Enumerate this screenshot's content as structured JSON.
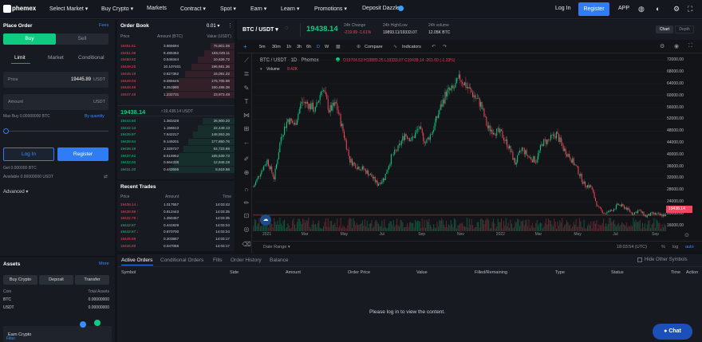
{
  "topbar": {
    "logo": "phemex",
    "nav": [
      "Select Market ▾",
      "Buy Crypto ▾",
      "Markets",
      "Contract ▾",
      "Spot ▾",
      "Earn ▾",
      "Learn ▾",
      "Promotions ▾",
      "Deposit Dazzle"
    ],
    "login": "Log In",
    "register": "Register",
    "app": "APP"
  },
  "order_form": {
    "title": "Place Order",
    "fees": "Fees",
    "buy": "Buy",
    "sell": "Sell",
    "tabs": [
      "Limit",
      "Market",
      "Conditional"
    ],
    "price_label": "Price",
    "price_value": "19445.89",
    "price_unit": "USDT",
    "amount_label": "Amount",
    "amount_unit": "USDT",
    "max_buy": "Max Buy 0.00000000 BTC",
    "by_quantity": "By quantity",
    "login_btn": "Log In",
    "register_btn": "Register",
    "get": "Get 0.000000 BTC",
    "available": "Available 0.00000000 USDT",
    "advanced": "Advanced ▾"
  },
  "assets": {
    "title": "Assets",
    "more": "More",
    "buttons": [
      "Buy Crypto",
      "Deposit",
      "Transfer"
    ],
    "coin_label": "Coin",
    "total_label": "Total Assets",
    "rows": [
      {
        "coin": "BTC",
        "total": "0.00000000"
      },
      {
        "coin": "USDT",
        "total": "0.00000000"
      }
    ],
    "earn": "Earn Crypto",
    "filter": "Filter"
  },
  "orderbook": {
    "title": "Order Book",
    "precision": "0.01 ▾",
    "headers": [
      "Price",
      "Amount (BTC)",
      "Value (USDT)"
    ],
    "asks": [
      [
        "19451.61",
        "3.865694",
        "76,801.06"
      ],
      [
        "19451.06",
        "8.485362",
        "165,049.11"
      ],
      [
        "19450.62",
        "0.546344",
        "10,626.72"
      ],
      [
        "19449.25",
        "10.107401",
        "196,581.36"
      ],
      [
        "19449.19",
        "0.827352",
        "16,091.32"
      ],
      [
        "19449.03",
        "9.085645",
        "176,706.98"
      ],
      [
        "19448.46",
        "8.251980",
        "160,486.38"
      ],
      [
        "19447.46",
        "1.232731",
        "23,973.48"
      ]
    ],
    "mid_price": "19438.14",
    "mid_value": "≈19,438.14 USDT",
    "bids": [
      [
        "19444.60",
        "1.383428",
        "26,900.20"
      ],
      [
        "19442.13",
        "1.156613",
        "22,448.13"
      ],
      [
        "19439.97",
        "7.642217",
        "148,553.26"
      ],
      [
        "19439.94",
        "9.149201",
        "177,850.76"
      ],
      [
        "19438.19",
        "3.329727",
        "64,723.86"
      ],
      [
        "19437.82",
        "8.516952",
        "165,539.73"
      ],
      [
        "19432.00",
        "0.664338",
        "12,948.28"
      ],
      [
        "19431.20",
        "0.443595",
        "8,619.58"
      ]
    ]
  },
  "trades": {
    "title": "Recent Trades",
    "headers": [
      "Price",
      "Amount",
      "Time"
    ],
    "rows": [
      [
        "19438.14 ↓",
        "1.017557",
        "14:03:43",
        "red"
      ],
      [
        "19438.99 ↑",
        "0.812443",
        "14:03:35",
        "red"
      ],
      [
        "19432.79 ↓",
        "1.350457",
        "14:03:35",
        "red"
      ],
      [
        "19442.87",
        "0.441929",
        "14:03:24",
        "green"
      ],
      [
        "19442.87 ↓",
        "0.870700",
        "14:03:24",
        "green"
      ],
      [
        "19445.89",
        "0.203867",
        "14:03:17",
        "red"
      ],
      [
        "19445.89",
        "0.047066",
        "14:03:17",
        "red"
      ]
    ]
  },
  "ticker": {
    "pair": "BTC / USDT ▾",
    "price": "19438.14",
    "change_label": "24h Change",
    "change_value": "-219.99 -1.61%",
    "hl_label": "24h High/Low",
    "hl_value": "19893.11/19333.07",
    "vol_label": "24h volume",
    "vol_value": "12.05K BTC",
    "view_chart": "Chart",
    "view_depth": "Depth"
  },
  "chart_toolbar": {
    "intervals": [
      "5m",
      "30m",
      "1h",
      "3h",
      "6h",
      "D",
      "W"
    ],
    "compare": "Compare",
    "indicators": "Indicators"
  },
  "chart_legend": {
    "symbol": "BTC / USDT · 1D · Phemex",
    "ohlc": "O19704.53 H19889.25 L19333.07 C19438.14 -261.60 (-1.33%)",
    "volume_label": "Volume",
    "volume_value": "9.42K"
  },
  "chart_footer": {
    "date_range": "Date Range ▾",
    "time": "18:03:54 (UTC)",
    "pct": "%",
    "log": "log",
    "auto": "auto"
  },
  "price_tag": "19438.14",
  "chart_data": {
    "type": "line",
    "x": [
      "2021",
      "Mar",
      "May",
      "Jul",
      "Sep",
      "Nov",
      "2022",
      "Mar",
      "May",
      "Jul",
      "Sep"
    ],
    "y_ticks": [
      72000,
      68000,
      64000,
      60000,
      56000,
      52000,
      48000,
      44000,
      40000,
      36000,
      32000,
      28000,
      24000,
      20000,
      16000
    ],
    "series": [
      {
        "values": [
          29000,
          34000,
          38000,
          32000,
          46000,
          52000,
          50000,
          58000,
          57000,
          55000,
          63000,
          55000,
          57000,
          48000,
          38000,
          36000,
          35000,
          33000,
          30000,
          32000,
          39000,
          42000,
          47000,
          45000,
          49000,
          44000,
          48000,
          55000,
          61000,
          62000,
          66000,
          63000,
          60000,
          57000,
          49000,
          48000,
          47000,
          43000,
          37000,
          42000,
          39000,
          38000,
          44000,
          45000,
          47000,
          42000,
          39000,
          35000,
          30000,
          29000,
          22000,
          20000,
          21000,
          23000,
          22000,
          20000,
          21000,
          19000,
          20000,
          19438
        ]
      }
    ],
    "ylim": [
      14000,
      74000
    ]
  },
  "orders_panel": {
    "tabs": [
      "Active Orders",
      "Conditional Orders",
      "Fills",
      "Order History",
      "Balance"
    ],
    "hide_other": "Hide Other Symbols",
    "columns": [
      "Symbol",
      "Side",
      "Amount",
      "Order Price",
      "Value",
      "Filled/Remaining",
      "Type",
      "Status",
      "Time",
      "Action"
    ],
    "empty": "Please log in to view the content."
  },
  "chat": "Chat"
}
